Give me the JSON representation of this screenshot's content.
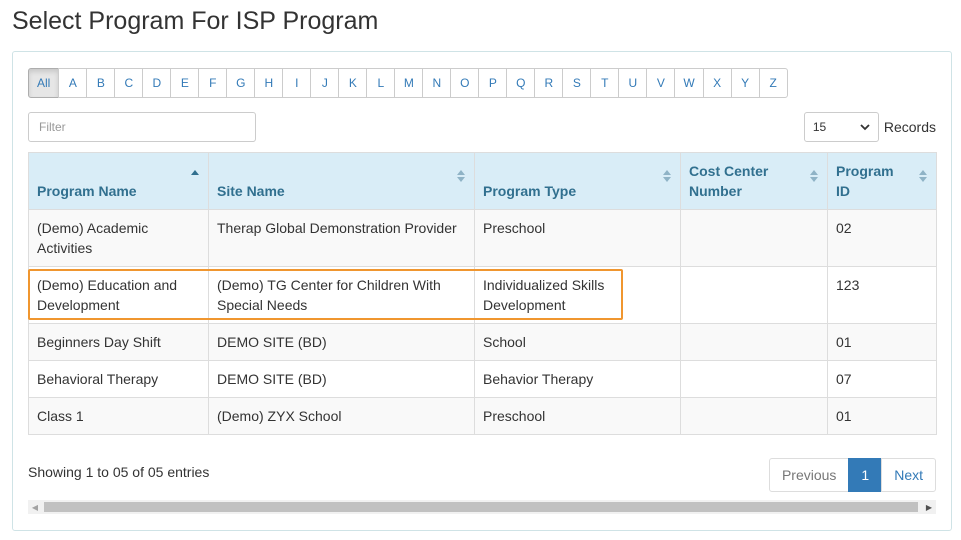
{
  "page": {
    "title": "Select Program For ISP Program"
  },
  "alphabet": [
    "All",
    "A",
    "B",
    "C",
    "D",
    "E",
    "F",
    "G",
    "H",
    "I",
    "J",
    "K",
    "L",
    "M",
    "N",
    "O",
    "P",
    "Q",
    "R",
    "S",
    "T",
    "U",
    "V",
    "W",
    "X",
    "Y",
    "Z"
  ],
  "active_letter": "All",
  "filter": {
    "placeholder": "Filter",
    "value": ""
  },
  "records": {
    "selected": "15",
    "label": "Records"
  },
  "table": {
    "columns": [
      {
        "line1": "",
        "line2": "Program Name",
        "sort": "asc"
      },
      {
        "line1": "",
        "line2": "Site Name",
        "sort": "both"
      },
      {
        "line1": "",
        "line2": "Program Type",
        "sort": "both"
      },
      {
        "line1": "Cost Center",
        "line2": "Number",
        "sort": "both"
      },
      {
        "line1": "Program",
        "line2": "ID",
        "sort": "both"
      }
    ],
    "rows": [
      [
        "(Demo) Academic Activities",
        "Therap Global Demonstration Provider",
        "Preschool",
        "",
        "02"
      ],
      [
        "(Demo) Education and Development",
        "(Demo) TG Center for Children With Special Needs",
        "Individualized Skills Development",
        "",
        "123"
      ],
      [
        "Beginners Day Shift",
        "DEMO SITE (BD)",
        "School",
        "",
        "01"
      ],
      [
        "Behavioral Therapy",
        "DEMO SITE (BD)",
        "Behavior Therapy",
        "",
        "07"
      ],
      [
        "Class 1",
        "(Demo) ZYX School",
        "Preschool",
        "",
        "01"
      ]
    ]
  },
  "footer": {
    "entries_info": "Showing 1 to 05 of 05 entries",
    "pagination": {
      "previous": "Previous",
      "current": "1",
      "next": "Next"
    }
  },
  "colors": {
    "header_bg": "#d9edf7",
    "header_text": "#31708f",
    "link": "#337ab7",
    "highlight": "#f0962f"
  }
}
